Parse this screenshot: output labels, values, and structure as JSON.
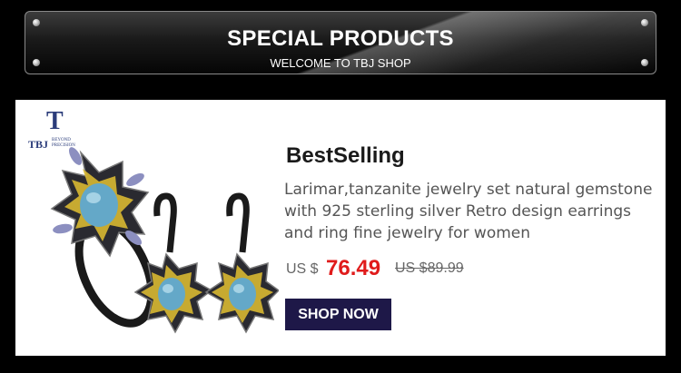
{
  "banner": {
    "title": "SPECIAL PRODUCTS",
    "subtitle": "WELCOME TO TBJ SHOP"
  },
  "brand": {
    "monogram": "T",
    "name": "TBJ",
    "tagline_line1": "BEYOND",
    "tagline_line2": "PRECISION",
    "color": "#2b3c7a"
  },
  "product": {
    "heading": "BestSelling",
    "description": "Larimar,tanzanite jewelry set natural gemstone with 925 sterling silver Retro design earrings and ring fine jewelry for women",
    "currency_label": "US $",
    "price": "76.49",
    "original_price": "US $89.99",
    "price_color": "#e01b1b",
    "image_icon": "jewelry-set-image"
  },
  "cta": {
    "label": "SHOP NOW",
    "color": "#1e1848"
  }
}
